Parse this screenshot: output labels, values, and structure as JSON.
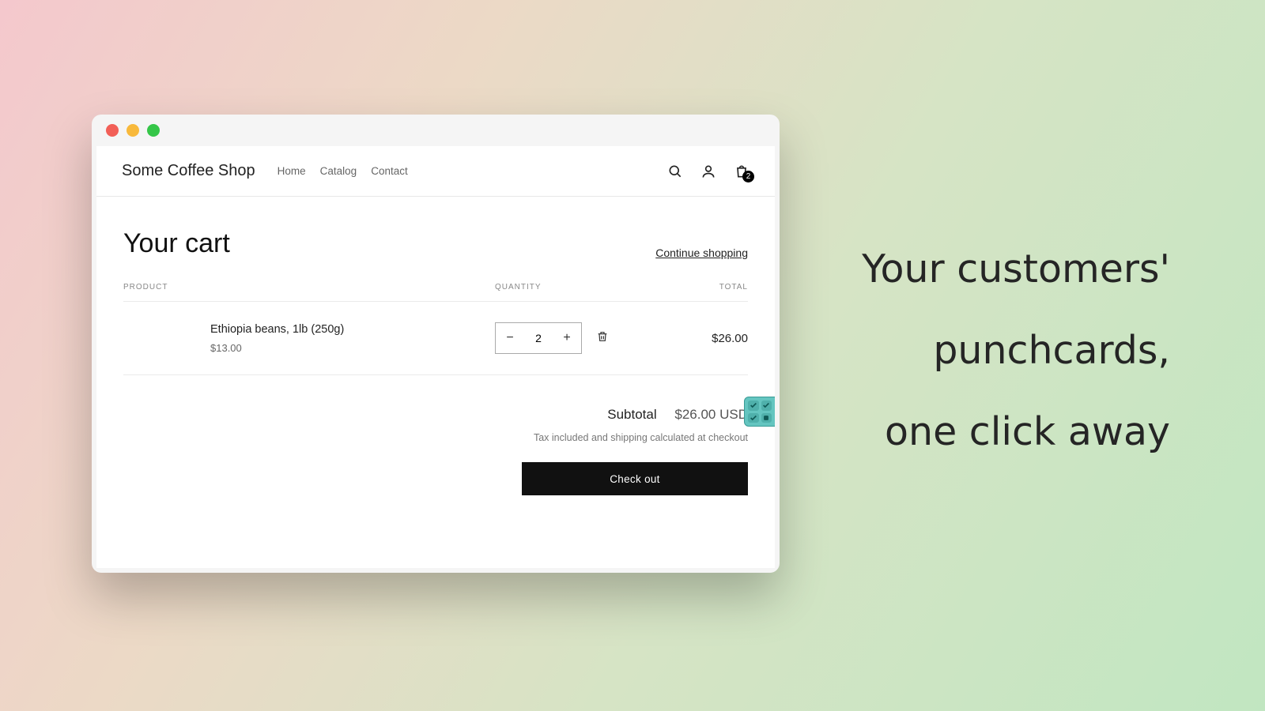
{
  "brand": "Some Coffee Shop",
  "nav": {
    "home": "Home",
    "catalog": "Catalog",
    "contact": "Contact"
  },
  "cart_badge": "2",
  "cart": {
    "title": "Your cart",
    "continue": "Continue shopping",
    "columns": {
      "product": "PRODUCT",
      "quantity": "QUANTITY",
      "total": "TOTAL"
    },
    "items": [
      {
        "name": "Ethiopia beans, 1lb (250g)",
        "unit_price": "$13.00",
        "qty": "2",
        "line_total": "$26.00"
      }
    ],
    "subtotal_label": "Subtotal",
    "subtotal_value": "$26.00 USD",
    "tax_note": "Tax included and shipping calculated at checkout",
    "checkout_label": "Check out"
  },
  "tagline": {
    "l1": "Your customers'",
    "l2": "punchcards,",
    "l3": "one click away"
  }
}
